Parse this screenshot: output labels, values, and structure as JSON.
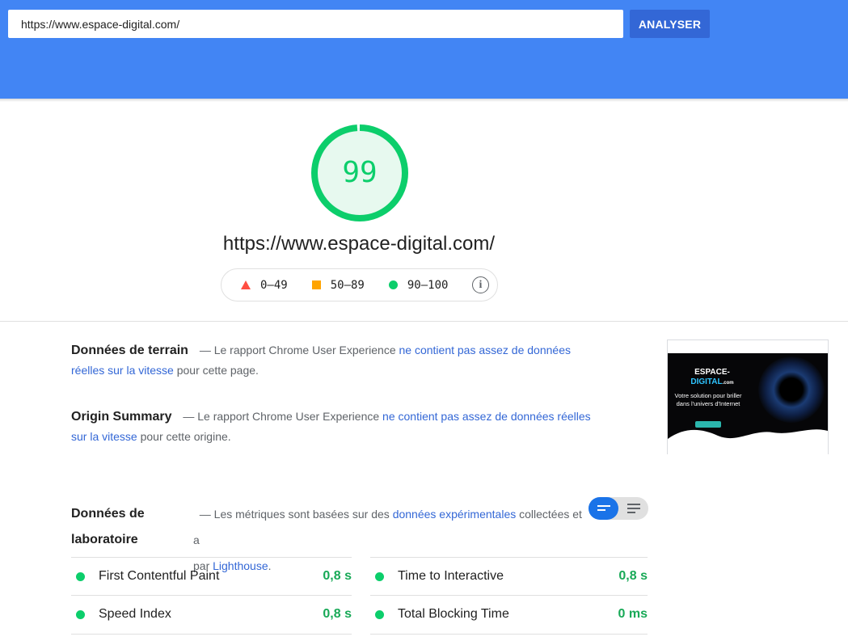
{
  "search": {
    "url_value": "https://www.espace-digital.com/",
    "analyze_label": "ANALYSER"
  },
  "score": {
    "value": "99",
    "fraction": 0.99,
    "color": "#0cce6b",
    "url": "https://www.espace-digital.com/"
  },
  "legend": {
    "poor": "0–49",
    "average": "50–89",
    "good": "90–100",
    "info_icon": "info-icon"
  },
  "field_data": {
    "title": "Données de terrain",
    "prefix": " — Le rapport Chrome User Experience ",
    "link": "ne contient pas assez de données réelles sur la vitesse",
    "suffix": " pour cette page."
  },
  "origin_summary": {
    "title": "Origin Summary",
    "prefix": " — Le rapport Chrome User Experience ",
    "link": "ne contient pas assez de données réelles sur la vitesse",
    "suffix": " pour cette origine."
  },
  "thumbnail": {
    "logo_line1": "ESPACE-",
    "logo_line2": "DIGITAL",
    "logo_suffix": ".com",
    "tagline": "Votre solution pour briller dans l'univers d'Internet"
  },
  "lab_data": {
    "title": "Données de laboratoire",
    "prefix": "— Les métriques sont basées sur des ",
    "link1": "données expérimentales",
    "middle": " collectées et a",
    "line2_prefix": "par ",
    "link2": "Lighthouse",
    "line2_suffix": "."
  },
  "metrics": [
    {
      "name": "First Contentful Paint",
      "value": "0,8 s"
    },
    {
      "name": "Time to Interactive",
      "value": "0,8 s"
    },
    {
      "name": "Speed Index",
      "value": "0,8 s"
    },
    {
      "name": "Total Blocking Time",
      "value": "0 ms"
    }
  ],
  "colors": {
    "header": "#4285f4",
    "button": "#3367d6",
    "good": "#0cce6b",
    "average": "#ffa400",
    "poor": "#ff4e42",
    "link": "#3367d6"
  }
}
